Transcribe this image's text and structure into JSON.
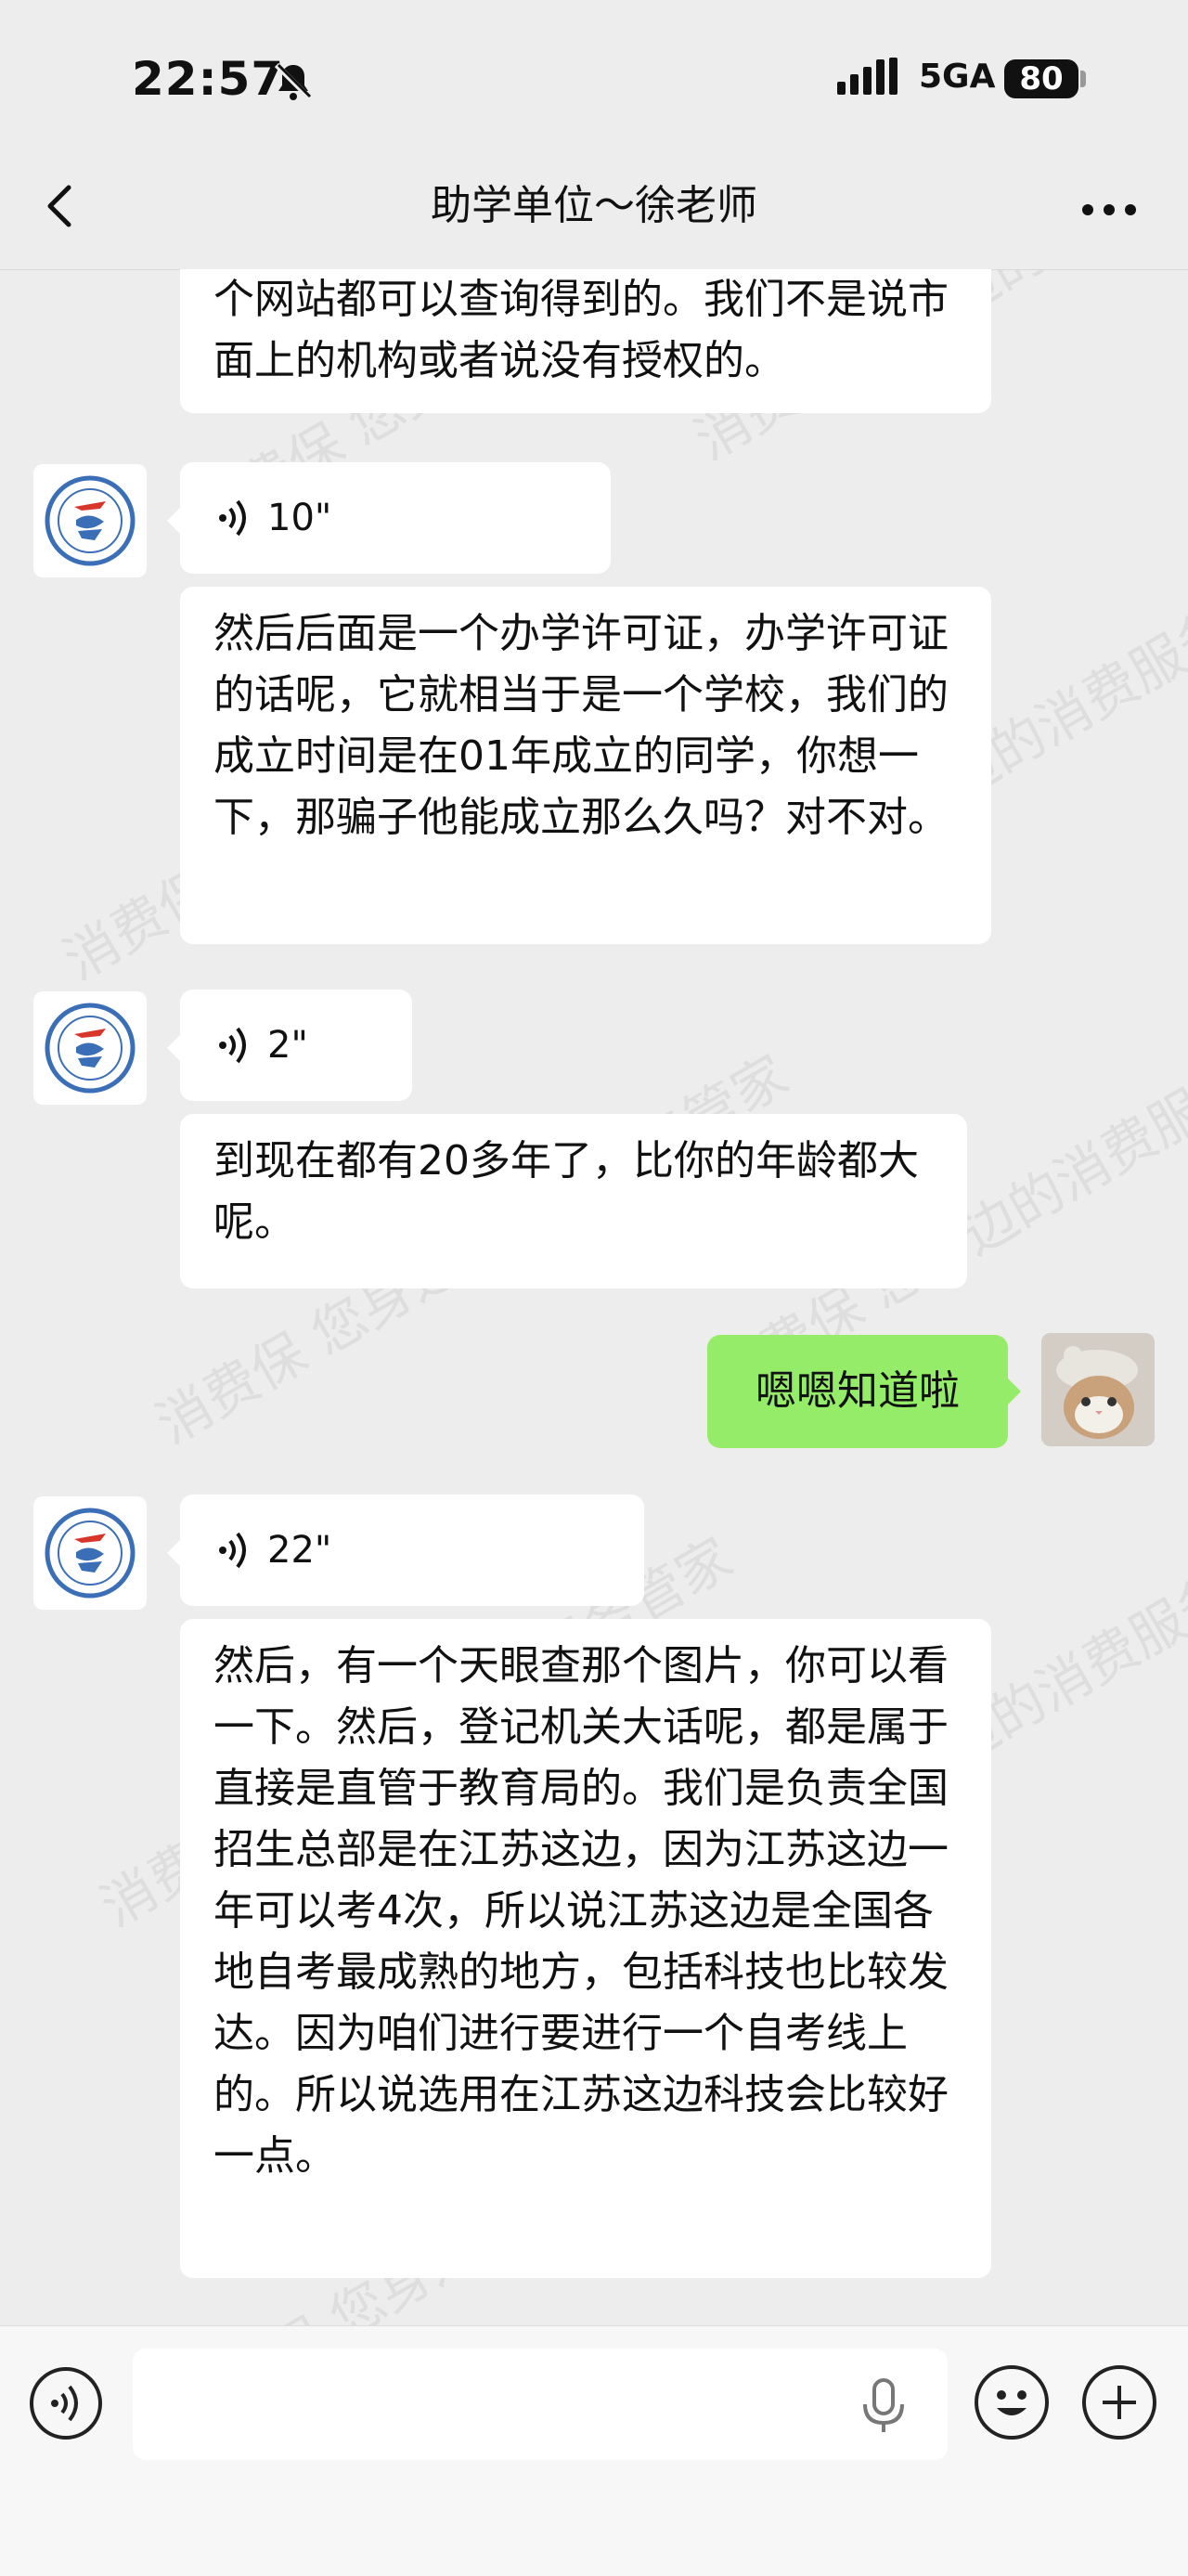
{
  "status_bar": {
    "time": "22:57",
    "network": "5GA",
    "battery": "80"
  },
  "nav": {
    "title": "助学单位～徐老师"
  },
  "messages": [
    {
      "text": "个网站都可以查询得到的。我们不是说市面上的机构或者说没有授权的。"
    },
    {
      "voice_duration": "10\""
    },
    {
      "text": "然后后面是一个办学许可证，办学许可证的话呢，它就相当于是一个学校，我们的成立时间是在01年成立的同学，你想一下，那骗子他能成立那么久吗？对不对。"
    },
    {
      "voice_duration": "2\""
    },
    {
      "text": "到现在都有20多年了，比你的年龄都大呢。"
    },
    {
      "text": "嗯嗯知道啦"
    },
    {
      "voice_duration": "22\""
    },
    {
      "text": "然后，有一个天眼查那个图片，你可以看一下。然后，登记机关大话呢，都是属于直接是直管于教育局的。我们是负责全国招生总部是在江苏这边，因为江苏这边一年可以考4次，所以说江苏这边是全国各地自考最成熟的地方，包括科技也比较发达。因为咱们进行要进行一个自考线上的。所以说选用在江苏这边科技会比较好一点。"
    }
  ],
  "input_bar": {
    "placeholder": ""
  },
  "watermark": "消费保 您身边的消费服务管家",
  "colors": {
    "background": "#ededed",
    "my_bubble": "#95ec69",
    "other_bubble": "#ffffff"
  },
  "icons": [
    "bell-off-icon",
    "signal-icon",
    "back-icon",
    "more-icon",
    "voice-wave-icon",
    "mic-icon",
    "emoji-icon",
    "plus-icon"
  ]
}
